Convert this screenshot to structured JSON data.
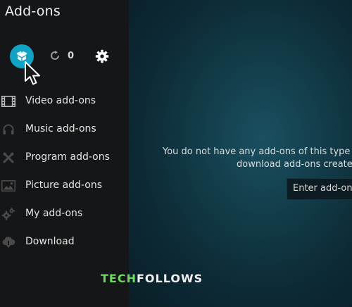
{
  "header": {
    "title": "Add-ons"
  },
  "toolbar": {
    "install_icon": "open-box-icon",
    "update_icon": "refresh-icon",
    "update_count": "0",
    "settings_icon": "gear-icon"
  },
  "sidebar": {
    "items": [
      {
        "label": "Video add-ons",
        "icon": "film-icon"
      },
      {
        "label": "Music add-ons",
        "icon": "headphones-icon"
      },
      {
        "label": "Program add-ons",
        "icon": "tools-icon"
      },
      {
        "label": "Picture add-ons",
        "icon": "picture-icon"
      },
      {
        "label": "My add-ons",
        "icon": "gears-icon"
      },
      {
        "label": "Download",
        "icon": "cloud-download-icon"
      }
    ]
  },
  "main": {
    "message_line1": "You do not have any add-ons of this type i",
    "message_line2": "download add-ons created",
    "enter_button_label": "Enter add-on b"
  },
  "watermark": {
    "part1": "TECH",
    "part2": "FOLLOWS"
  },
  "colors": {
    "accent": "#12a3c4",
    "sidebar_bg": "#151617",
    "watermark_green": "#6bdc5c"
  }
}
